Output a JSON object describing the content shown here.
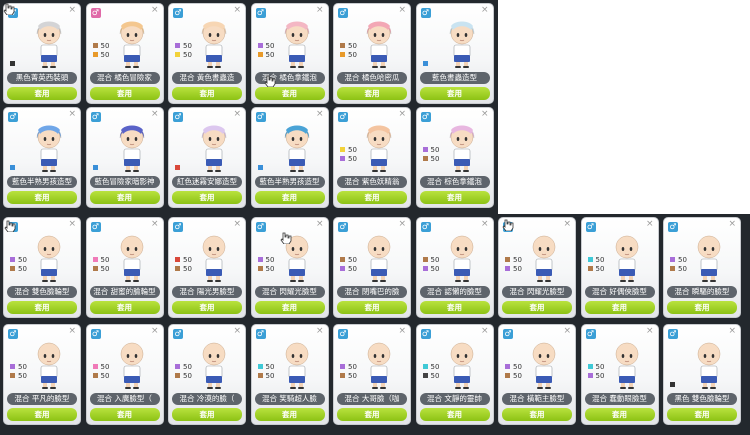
{
  "ui": {
    "apply_label": "套用",
    "male_glyph": "♂"
  },
  "cards": [
    {
      "name": "黑色菁英西裝頭",
      "hair": "#d4d4d6",
      "female": false,
      "swatches": [
        {
          "c": "#333333",
          "t": ""
        }
      ],
      "bald": false
    },
    {
      "name": "混合 橘色冒險家",
      "hair": "#f4c78f",
      "female": true,
      "swatches": [
        {
          "c": "#b07a4a",
          "t": "50"
        },
        {
          "c": "#e89a2a",
          "t": "50"
        }
      ],
      "bald": false
    },
    {
      "name": "混合 黃色書蟲造",
      "hair": "#f7d6b4",
      "female": false,
      "swatches": [
        {
          "c": "#a86ed8",
          "t": "50"
        },
        {
          "c": "#f2d23a",
          "t": "50"
        }
      ],
      "bald": false
    },
    {
      "name": "混合 橘色拿鐵泡",
      "hair": "#f4b7c4",
      "female": false,
      "swatches": [
        {
          "c": "#a86ed8",
          "t": "50"
        },
        {
          "c": "#e89a2a",
          "t": "50"
        }
      ],
      "bald": false
    },
    {
      "name": "混合 橘色哈密瓜",
      "hair": "#f3a7b5",
      "female": false,
      "swatches": [
        {
          "c": "#b07a4a",
          "t": "50"
        },
        {
          "c": "#e89a2a",
          "t": "50"
        }
      ],
      "bald": false
    },
    {
      "name": "藍色書蟲造型",
      "hair": "#c9e3f1",
      "female": false,
      "swatches": [
        {
          "c": "#3a8fd8",
          "t": ""
        }
      ],
      "bald": false
    },
    {
      "name": "藍色半熟男孩造型",
      "hair": "#6fa6e8",
      "female": false,
      "swatches": [
        {
          "c": "#3a8fd8",
          "t": ""
        }
      ],
      "bald": false
    },
    {
      "name": "藍色冒險家暗影神",
      "hair": "#5a63c8",
      "female": false,
      "swatches": [
        {
          "c": "#3a8fd8",
          "t": ""
        }
      ],
      "bald": false
    },
    {
      "name": "紅色迷霧安娜造型",
      "hair": "#dcc7ef",
      "female": false,
      "swatches": [
        {
          "c": "#d9483a",
          "t": ""
        }
      ],
      "bald": false
    },
    {
      "name": "藍色半熟男孩造型",
      "hair": "#4aa3d6",
      "female": false,
      "swatches": [
        {
          "c": "#3a8fd8",
          "t": ""
        }
      ],
      "bald": false
    },
    {
      "name": "混合 紫色妖精翁",
      "hair": "#f4c4a0",
      "female": false,
      "swatches": [
        {
          "c": "#f2d23a",
          "t": "50"
        },
        {
          "c": "#a86ed8",
          "t": "50"
        }
      ],
      "bald": false
    },
    {
      "name": "混合 棕色拿鐵泡",
      "hair": "#e8b7e0",
      "female": false,
      "swatches": [
        {
          "c": "#a86ed8",
          "t": "50"
        },
        {
          "c": "#b07a4a",
          "t": "50"
        }
      ],
      "bald": false
    },
    {
      "name": "混合 雙色臉輪型",
      "female": false,
      "swatches": [
        {
          "c": "#a86ed8",
          "t": "50"
        },
        {
          "c": "#b07a4a",
          "t": "50"
        }
      ],
      "bald": true
    },
    {
      "name": "混合 甜蜜的臉輪型",
      "female": false,
      "swatches": [
        {
          "c": "#f07ab8",
          "t": "50"
        },
        {
          "c": "#b07a4a",
          "t": "50"
        }
      ],
      "bald": true
    },
    {
      "name": "混合 陽光男臉型",
      "female": false,
      "swatches": [
        {
          "c": "#d9483a",
          "t": "50"
        },
        {
          "c": "#b07a4a",
          "t": "50"
        }
      ],
      "bald": true
    },
    {
      "name": "混合 閃耀光臉型",
      "female": false,
      "swatches": [
        {
          "c": "#a86ed8",
          "t": "50"
        },
        {
          "c": "#b07a4a",
          "t": "50"
        }
      ],
      "bald": true
    },
    {
      "name": "混合 閉嘴巴的臉",
      "female": false,
      "swatches": [
        {
          "c": "#b07a4a",
          "t": "50"
        },
        {
          "c": "#a86ed8",
          "t": "50"
        }
      ],
      "bald": true
    },
    {
      "name": "混合 認懶的臉型",
      "female": false,
      "swatches": [
        {
          "c": "#b07a4a",
          "t": "50"
        },
        {
          "c": "#a86ed8",
          "t": "50"
        }
      ],
      "bald": true
    },
    {
      "name": "混合 閃耀光臉型",
      "female": false,
      "swatches": [
        {
          "c": "#b07a4a",
          "t": "50"
        },
        {
          "c": "#a86ed8",
          "t": "50"
        }
      ],
      "bald": true
    },
    {
      "name": "混合 好偶俠臉型",
      "female": false,
      "swatches": [
        {
          "c": "#3fc9d6",
          "t": "50"
        },
        {
          "c": "#b07a4a",
          "t": "50"
        }
      ],
      "bald": true
    },
    {
      "name": "混合 瞬驅的臉型",
      "female": false,
      "swatches": [
        {
          "c": "#a86ed8",
          "t": "50"
        },
        {
          "c": "#b07a4a",
          "t": "50"
        }
      ],
      "bald": true
    },
    {
      "name": "混合 平凡的臉型",
      "female": false,
      "swatches": [
        {
          "c": "#a86ed8",
          "t": "50"
        },
        {
          "c": "#b07a4a",
          "t": "50"
        }
      ],
      "bald": true
    },
    {
      "name": "混合 入廣臉型（",
      "female": false,
      "swatches": [
        {
          "c": "#f07ab8",
          "t": "50"
        },
        {
          "c": "#b07a4a",
          "t": "50"
        }
      ],
      "bald": true
    },
    {
      "name": "混合 冷漠的臉（",
      "female": false,
      "swatches": [
        {
          "c": "#a86ed8",
          "t": "50"
        },
        {
          "c": "#b07a4a",
          "t": "50"
        }
      ],
      "bald": true
    },
    {
      "name": "混合 笑騎超人臉",
      "female": false,
      "swatches": [
        {
          "c": "#3fc9d6",
          "t": "50"
        },
        {
          "c": "#b07a4a",
          "t": "50"
        }
      ],
      "bald": true
    },
    {
      "name": "混合 大哥臉（咖",
      "female": false,
      "swatches": [
        {
          "c": "#a86ed8",
          "t": "50"
        },
        {
          "c": "#b07a4a",
          "t": "50"
        }
      ],
      "bald": true
    },
    {
      "name": "混合 文靜的靈帥",
      "female": false,
      "swatches": [
        {
          "c": "#3fc9d6",
          "t": "50"
        },
        {
          "c": "#444444",
          "t": "50"
        }
      ],
      "bald": true
    },
    {
      "name": "混合 橫範主臉型",
      "female": false,
      "swatches": [
        {
          "c": "#a86ed8",
          "t": "50"
        },
        {
          "c": "#b07a4a",
          "t": "50"
        }
      ],
      "bald": true
    },
    {
      "name": "混合 蠢動眼臉型",
      "female": false,
      "swatches": [
        {
          "c": "#3fc9d6",
          "t": "50"
        },
        {
          "c": "#a86ed8",
          "t": "50"
        }
      ],
      "bald": true
    },
    {
      "name": "黑色 雙色臉輪型",
      "female": false,
      "swatches": [
        {
          "c": "#333333",
          "t": ""
        }
      ],
      "bald": true
    }
  ]
}
